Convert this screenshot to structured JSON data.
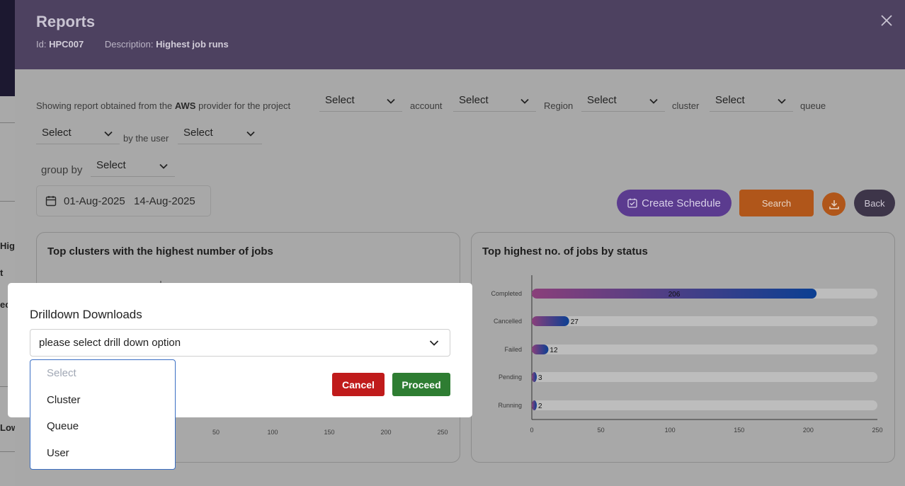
{
  "background": {
    "fragments": [
      "High",
      "t",
      "ec",
      "Low"
    ]
  },
  "header": {
    "title": "Reports",
    "id_label": "Id:",
    "id_value": "HPC007",
    "description_label": "Description:",
    "description_value": "Highest job runs"
  },
  "filters": {
    "text_prefix": "Showing report obtained from the",
    "provider": "AWS",
    "text_provider_suffix": "provider for the project",
    "account_label": "account",
    "region_label": "Region",
    "cluster_label": "cluster",
    "queue_label": "queue",
    "user_label": "by the user",
    "group_by_label": "group by",
    "select_value": "Select",
    "date_start": "01-Aug-2025",
    "date_end": "14-Aug-2025"
  },
  "actions": {
    "create_schedule": "Create Schedule",
    "search": "Search",
    "back": "Back"
  },
  "cards": {
    "left_title": "Top clusters with the highest number of jobs",
    "right_title": "Top highest no. of jobs by status"
  },
  "chart_data": [
    {
      "type": "bar",
      "orientation": "horizontal",
      "title": "Top highest no. of jobs by status",
      "categories": [
        "Completed",
        "Cancelled",
        "Failed",
        "Pending",
        "Running"
      ],
      "values": [
        206,
        27,
        12,
        3,
        2
      ],
      "xlim": [
        0,
        250
      ],
      "xticks": [
        0,
        50,
        100,
        150,
        200,
        250
      ],
      "bar_gradient": [
        "#8a3f7a",
        "#0b3f92"
      ],
      "track_color": "#bdbdbd"
    },
    {
      "type": "bar",
      "orientation": "horizontal",
      "title": "Top clusters with the highest number of jobs",
      "xticks_visible": [
        50,
        100,
        150,
        200,
        250
      ],
      "note": "partially hidden behind modal"
    }
  ],
  "modal": {
    "title": "Drilldown Downloads",
    "select_value": "please select drill down option",
    "cancel": "Cancel",
    "proceed": "Proceed",
    "options": [
      "Select",
      "Cluster",
      "Queue",
      "User"
    ]
  },
  "colors": {
    "header_bg": "#4d4160",
    "schedule_btn": "#5b3b8f",
    "search_btn": "#b0561a",
    "back_btn": "#3d3549",
    "cancel_btn": "#c01b1b",
    "proceed_btn": "#2e7d32"
  }
}
